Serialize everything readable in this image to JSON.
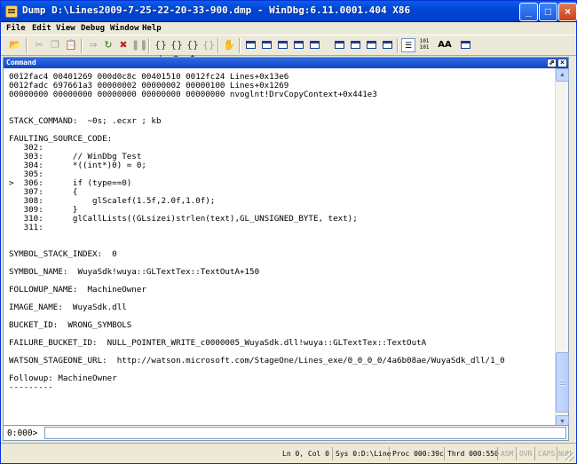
{
  "window": {
    "title": "Dump D:\\Lines2009-7-25-22-20-33-900.dmp - WinDbg:6.11.0001.404 X86",
    "minimize_glyph": "_",
    "maximize_glyph": "□",
    "close_glyph": "×"
  },
  "menu": [
    "File",
    "Edit",
    "View",
    "Debug",
    "Window",
    "Help"
  ],
  "toolbar": {
    "icons": [
      "open-icon",
      "cut-icon",
      "copy-icon",
      "paste-icon",
      "go-icon",
      "restart-icon",
      "stop-debugging-icon",
      "break-icon",
      "step-into-icon",
      "step-over-icon",
      "step-out-icon",
      "run-to-cursor-icon",
      "hand-icon",
      "command-icon",
      "watch-icon",
      "locals-icon",
      "registers-icon",
      "memory-icon",
      "call-stack-icon",
      "disassembly-icon",
      "scratch-pad-icon",
      "source-mode-icon",
      "hex-mode-icon",
      "font-icon",
      "options-icon"
    ],
    "hex_label": "101\n101",
    "font_label": "AA"
  },
  "panel": {
    "title": "Command",
    "float_glyph": "⇗",
    "close_glyph": "×"
  },
  "output": {
    "lines": [
      "0012fac4 00401269 000d0c8c 00401510 0012fc24 Lines+0x13e6",
      "0012fadc 697661a3 00000002 00000002 00000100 Lines+0x1269",
      "00000000 00000000 00000000 00000000 00000000 nvoglnt!DrvCopyContext+0x441e3",
      "",
      "",
      "STACK_COMMAND:  ~0s; .ecxr ; kb",
      "",
      "FAULTING_SOURCE_CODE:",
      "   302:",
      "   303:      // WinDbg Test",
      "   304:      *((int*)0) = 0;",
      "   305:",
      ">  306:      if (type==0)",
      "   307:      {",
      "   308:          glScalef(1.5f,2.0f,1.0f);",
      "   309:      }",
      "   310:      glCallLists((GLsizei)strlen(text),GL_UNSIGNED_BYTE, text);",
      "   311:",
      "",
      "",
      "SYMBOL_STACK_INDEX:  0",
      "",
      "SYMBOL_NAME:  WuyaSdk!wuya::GLTextTex::TextOutA+150",
      "",
      "FOLLOWUP_NAME:  MachineOwner",
      "",
      "IMAGE_NAME:  WuyaSdk.dll",
      "",
      "BUCKET_ID:  WRONG_SYMBOLS",
      "",
      "FAILURE_BUCKET_ID:  NULL_POINTER_WRITE_c0000005_WuyaSdk.dll!wuya::GLTextTex::TextOutA",
      "",
      "WATSON_STAGEONE_URL:  http://watson.microsoft.com/StageOne/Lines_exe/0_0_0_0/4a6b08ae/WuyaSdk_dll/1_0",
      "",
      "Followup: MachineOwner",
      "---------"
    ]
  },
  "command": {
    "prompt": "0:000>",
    "value": ""
  },
  "status": {
    "position": "Ln 0, Col 0",
    "sys": "Sys 0:D:\\Line",
    "proc": "Proc 000:39c",
    "thrd": "Thrd 000:550",
    "asm": "ASM",
    "ovr": "OVR",
    "caps": "CAPS",
    "num": "NUM"
  }
}
